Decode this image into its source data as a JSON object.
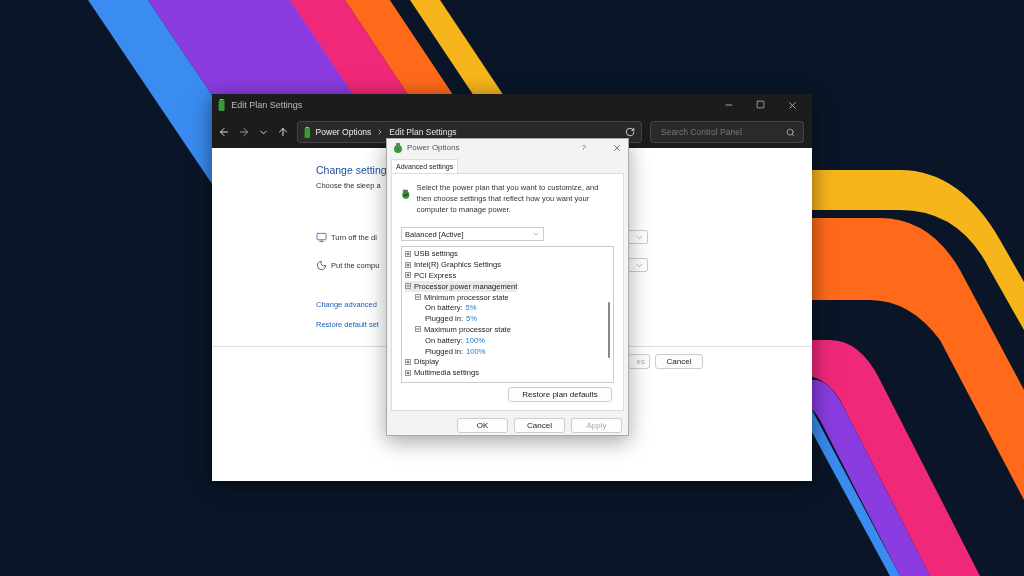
{
  "main_window": {
    "title": "Edit Plan Settings",
    "breadcrumb": [
      "Power Options",
      "Edit Plan Settings"
    ],
    "search": {
      "placeholder": "Search Control Panel"
    },
    "heading": "Change setting",
    "subtitle": "Choose the sleep a",
    "settings": [
      {
        "kind": "display",
        "label": "Turn off the di"
      },
      {
        "kind": "sleep",
        "label": "Put the compu"
      }
    ],
    "links": [
      "Change advanced",
      "Restore default set"
    ],
    "buttons": [
      {
        "label": "es",
        "disabled": true
      },
      {
        "label": "Cancel",
        "disabled": false
      }
    ]
  },
  "dialog": {
    "title": "Power Options",
    "help": "?",
    "tabs": [
      {
        "label": "Advanced settings",
        "selected": true
      }
    ],
    "intro": "Select the power plan that you want to customize, and then choose settings that reflect how you want your computer to manage power.",
    "plan": {
      "value": "Balanced [Active]"
    },
    "tree": [
      {
        "label": "USB settings",
        "expanded": false,
        "selected": false
      },
      {
        "label": "Intel(R) Graphics Settings",
        "expanded": false,
        "selected": false
      },
      {
        "label": "PCI Express",
        "expanded": false,
        "selected": false
      },
      {
        "label": "Processor power management",
        "expanded": true,
        "selected": true,
        "children": [
          {
            "label": "Minimum processor state",
            "expanded": true,
            "selected": false,
            "children": [
              {
                "label": "On battery:",
                "value": "5%",
                "selected": false
              },
              {
                "label": "Plugged in:",
                "value": "5%",
                "selected": false
              }
            ]
          },
          {
            "label": "Maximum processor state",
            "expanded": true,
            "selected": false,
            "children": [
              {
                "label": "On battery:",
                "value": "100%",
                "selected": false
              },
              {
                "label": "Plugged in:",
                "value": "100%",
                "selected": false
              }
            ]
          }
        ]
      },
      {
        "label": "Display",
        "expanded": false,
        "selected": false
      },
      {
        "label": "Multimedia settings",
        "expanded": false,
        "selected": false
      }
    ],
    "restore_button": "Restore plan defaults",
    "buttons": [
      {
        "label": "OK",
        "disabled": false
      },
      {
        "label": "Cancel",
        "disabled": false
      },
      {
        "label": "Apply",
        "disabled": true
      }
    ]
  }
}
